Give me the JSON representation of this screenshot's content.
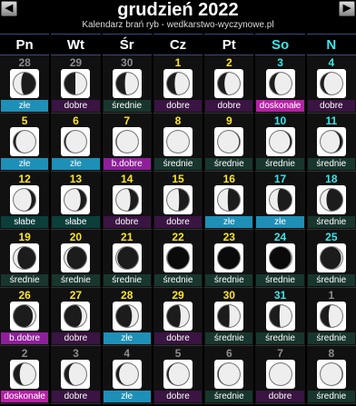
{
  "header": {
    "title": "grudzień 2022",
    "subtitle": "Kalendarz brań ryb - wedkarstwo-wyczynowe.pl",
    "prev": "◀",
    "next": "▶"
  },
  "weekdays": [
    {
      "label": "Pn",
      "color": "#ffffff"
    },
    {
      "label": "Wt",
      "color": "#ffffff"
    },
    {
      "label": "Śr",
      "color": "#ffffff"
    },
    {
      "label": "Cz",
      "color": "#ffffff"
    },
    {
      "label": "Pt",
      "color": "#ffffff"
    },
    {
      "label": "So",
      "color": "#39e6ea"
    },
    {
      "label": "N",
      "color": "#39e6ea"
    }
  ],
  "rating_colors": {
    "złe": "#1e8fb6",
    "dobre": "#3a1442",
    "średnie": "#18362e",
    "doskonałe": "#b322a4",
    "b.dobre": "#8e1f99",
    "słabe": "#0c3e3a"
  },
  "days": [
    {
      "day": "28",
      "other": true,
      "rating": "złe",
      "illum": 0.35,
      "waxing": false
    },
    {
      "day": "29",
      "other": true,
      "rating": "dobre",
      "illum": 0.5,
      "waxing": true
    },
    {
      "day": "30",
      "other": true,
      "rating": "średnie",
      "illum": 0.6,
      "waxing": true
    },
    {
      "day": "1",
      "rating": "dobre",
      "illum": 0.65,
      "waxing": true
    },
    {
      "day": "2",
      "rating": "dobre",
      "illum": 0.7,
      "waxing": true
    },
    {
      "day": "3",
      "rating": "doskonałe",
      "illum": 0.78,
      "waxing": true
    },
    {
      "day": "4",
      "rating": "dobre",
      "illum": 0.85,
      "waxing": true
    },
    {
      "day": "5",
      "rating": "złe",
      "illum": 0.9,
      "waxing": true
    },
    {
      "day": "6",
      "rating": "złe",
      "illum": 0.94,
      "waxing": true
    },
    {
      "day": "7",
      "rating": "b.dobre",
      "illum": 0.98,
      "waxing": true
    },
    {
      "day": "8",
      "rating": "średnie",
      "illum": 1.0,
      "waxing": true
    },
    {
      "day": "9",
      "rating": "średnie",
      "illum": 0.97,
      "waxing": false
    },
    {
      "day": "10",
      "rating": "średnie",
      "illum": 0.93,
      "waxing": false
    },
    {
      "day": "11",
      "rating": "średnie",
      "illum": 0.88,
      "waxing": false
    },
    {
      "day": "12",
      "rating": "słabe",
      "illum": 0.82,
      "waxing": false
    },
    {
      "day": "13",
      "rating": "słabe",
      "illum": 0.74,
      "waxing": false
    },
    {
      "day": "14",
      "rating": "dobre",
      "illum": 0.65,
      "waxing": false
    },
    {
      "day": "15",
      "rating": "dobre",
      "illum": 0.55,
      "waxing": false
    },
    {
      "day": "16",
      "rating": "złe",
      "illum": 0.45,
      "waxing": false
    },
    {
      "day": "17",
      "rating": "złe",
      "illum": 0.36,
      "waxing": false
    },
    {
      "day": "18",
      "rating": "średnie",
      "illum": 0.27,
      "waxing": false
    },
    {
      "day": "19",
      "rating": "średnie",
      "illum": 0.18,
      "waxing": false
    },
    {
      "day": "20",
      "rating": "średnie",
      "illum": 0.11,
      "waxing": false
    },
    {
      "day": "21",
      "rating": "średnie",
      "illum": 0.05,
      "waxing": false
    },
    {
      "day": "22",
      "rating": "średnie",
      "illum": 0.01,
      "waxing": false
    },
    {
      "day": "23",
      "rating": "średnie",
      "illum": 0.0,
      "waxing": true
    },
    {
      "day": "24",
      "rating": "średnie",
      "illum": 0.02,
      "waxing": true
    },
    {
      "day": "25",
      "rating": "średnie",
      "illum": 0.06,
      "waxing": true
    },
    {
      "day": "26",
      "rating": "b.dobre",
      "illum": 0.12,
      "waxing": true
    },
    {
      "day": "27",
      "rating": "dobre",
      "illum": 0.2,
      "waxing": true
    },
    {
      "day": "28",
      "rating": "złe",
      "illum": 0.28,
      "waxing": true
    },
    {
      "day": "29",
      "rating": "dobre",
      "illum": 0.38,
      "waxing": true
    },
    {
      "day": "30",
      "rating": "średnie",
      "illum": 0.47,
      "waxing": true
    },
    {
      "day": "31",
      "rating": "średnie",
      "illum": 0.55,
      "waxing": true
    },
    {
      "day": "1",
      "other": true,
      "rating": "średnie",
      "illum": 0.63,
      "waxing": true
    },
    {
      "day": "2",
      "other": true,
      "rating": "doskonałe",
      "illum": 0.72,
      "waxing": true
    },
    {
      "day": "3",
      "other": true,
      "rating": "dobre",
      "illum": 0.8,
      "waxing": true
    },
    {
      "day": "4",
      "other": true,
      "rating": "złe",
      "illum": 0.87,
      "waxing": true
    },
    {
      "day": "5",
      "other": true,
      "rating": "dobre",
      "illum": 0.93,
      "waxing": true
    },
    {
      "day": "6",
      "other": true,
      "rating": "średnie",
      "illum": 0.97,
      "waxing": true
    },
    {
      "day": "7",
      "other": true,
      "rating": "dobre",
      "illum": 1.0,
      "waxing": true
    },
    {
      "day": "8",
      "other": true,
      "rating": "średnie",
      "illum": 0.98,
      "waxing": false
    }
  ],
  "colors": {
    "day_weekday": "#ffe61c",
    "day_weekend": "#39e6ea",
    "day_other": "#8c8c8c"
  }
}
